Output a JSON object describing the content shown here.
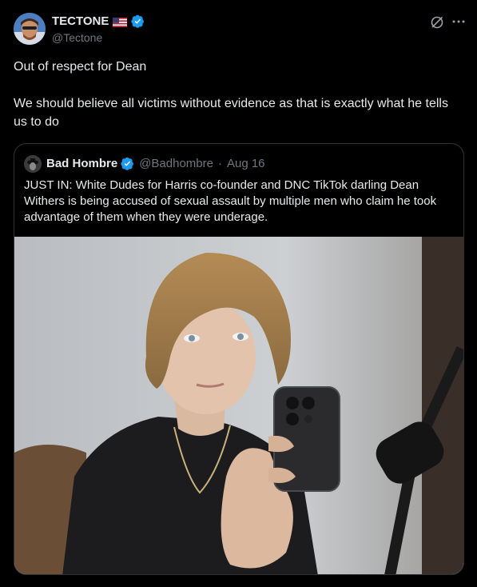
{
  "author": {
    "display_name": "TECTONE",
    "handle": "@Tectone"
  },
  "tweet": {
    "line1": "Out of respect for Dean",
    "line2": "We should believe all victims without evidence as that is exactly what he tells us to do"
  },
  "quote": {
    "display_name": "Bad Hombre",
    "handle": "@Badhombre",
    "separator": "·",
    "date": "Aug 16",
    "text": "JUST IN: White Dudes for Harris co-founder and DNC TikTok darling Dean Withers is being accused of sexual assault by multiple men who claim he took advantage of them when they were underage."
  },
  "icons": {
    "verified": "verified-badge-icon",
    "flag": "us-flag-icon",
    "grok": "grok-icon",
    "more": "more-icon"
  },
  "colors": {
    "background": "#000000",
    "text": "#e7e9ea",
    "secondary": "#71767b",
    "verified": "#1d9bf0",
    "border": "#2f3336"
  }
}
